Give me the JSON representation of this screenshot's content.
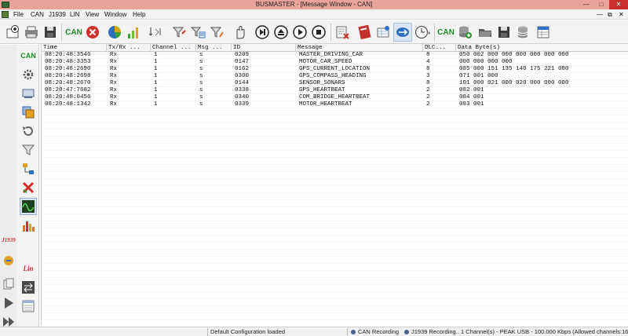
{
  "window": {
    "title": "BUSMASTER - [Message Window - CAN]",
    "minimize_glyph": "—",
    "maximize_glyph": "□",
    "close_glyph": "✕"
  },
  "menu": {
    "items": [
      "File",
      "CAN",
      "J1939",
      "LIN",
      "View",
      "Window",
      "Help"
    ],
    "right_minimize": "—",
    "right_restore": "⧉",
    "right_close": "✕"
  },
  "toolbar": {
    "can_label": "CAN",
    "can2_label": "CAN"
  },
  "siderail": {
    "can_label": "CAN",
    "j1939_label": "J1939",
    "lin_label": "Lin"
  },
  "grid": {
    "headers": [
      "Time",
      "Tx/Rx ...",
      "Channel ...",
      "Msg ...",
      "ID",
      "Message",
      "DLC...",
      "Data Byte(s)"
    ],
    "rows": [
      [
        "08:20:48:3546",
        "Rx",
        "1",
        "s",
        "0209",
        "MASTER_DRIVING_CAR",
        "8",
        "050 002 000 000 000 000 000 000"
      ],
      [
        "08:20:48:3353",
        "Rx",
        "1",
        "s",
        "0147",
        "MOTOR_CAR_SPEED",
        "4",
        "000 000 000 000"
      ],
      [
        "08:20:48:2690",
        "Rx",
        "1",
        "s",
        "0162",
        "GPS_CURRENT_LOCATION",
        "8",
        "085 000 151 135 140 175 221 000"
      ],
      [
        "08:20:48:2698",
        "Rx",
        "1",
        "s",
        "0300",
        "GPS_COMPASS_HEADING",
        "3",
        "071 001 000"
      ],
      [
        "08:20:48:2670",
        "Rx",
        "1",
        "s",
        "0144",
        "SENSOR_SONARS",
        "8",
        "101 000 021 000 020 000 000 000"
      ],
      [
        "08:20:47:7682",
        "Rx",
        "1",
        "s",
        "0338",
        "GPS_HEARTBEAT",
        "2",
        "082 001"
      ],
      [
        "08:20:48:0456",
        "Rx",
        "1",
        "s",
        "0340",
        "COM_BRIDGE_HEARTBEAT",
        "2",
        "084 001"
      ],
      [
        "08:20:48:1342",
        "Rx",
        "1",
        "s",
        "0339",
        "MOTOR_HEARTBEAT",
        "2",
        "083 001"
      ]
    ]
  },
  "status": {
    "config": "Default Configuration loaded",
    "can_recording": "CAN Recording",
    "j1939_recording": "J1939 Recording...",
    "channel_info": "1 Channel(s) - PEAK USB - 100.000 Kbps (Allowed channels:16"
  },
  "colors": {
    "titlebar": "#e8a49a",
    "close_button": "#c7302b",
    "can_green": "#1f8a2a",
    "error_red": "#d0312d",
    "accent_blue": "#2f6fc1"
  }
}
